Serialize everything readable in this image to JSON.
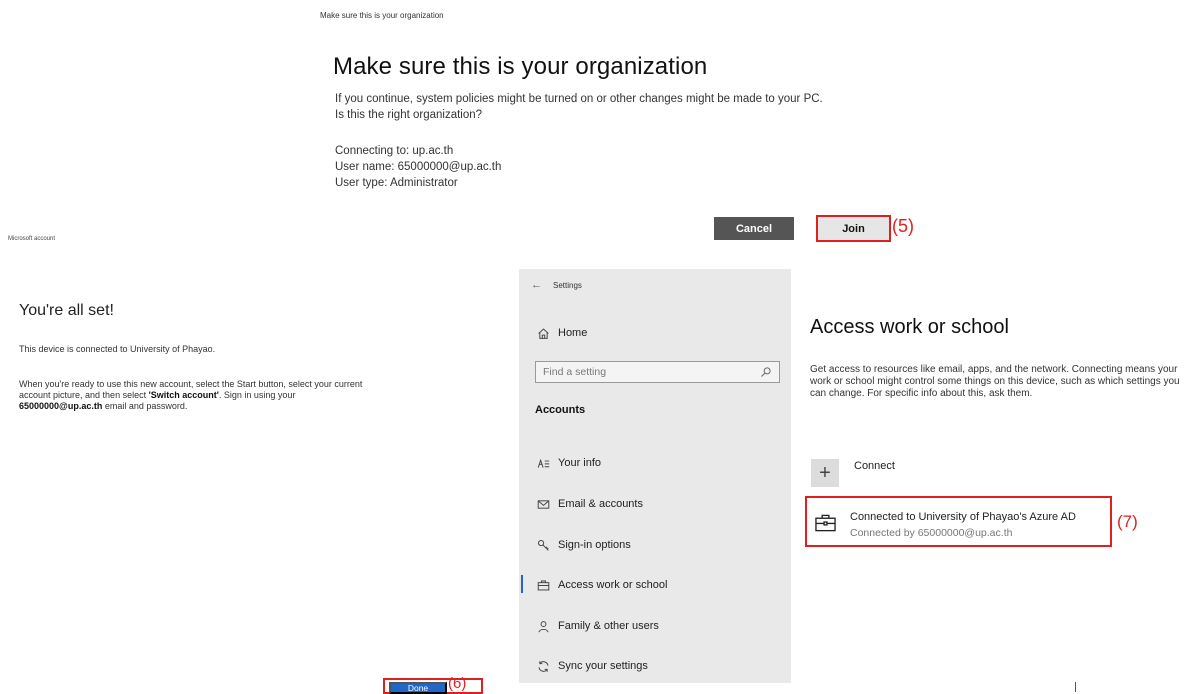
{
  "join_dialog": {
    "caption": "Make sure this is your organization",
    "title": "Make sure this is your organization",
    "message_line1": "If you continue, system policies might be turned on or other changes might be made to your PC.",
    "message_line2": "Is this the right organization?",
    "connecting_to": "Connecting to: up.ac.th",
    "user_name": "User name: 65000000@up.ac.th",
    "user_type": "User type: Administrator",
    "cancel_label": "Cancel",
    "join_label": "Join",
    "step_label": "(5)"
  },
  "all_set": {
    "caption": "Microsoft account",
    "title": "You're all set!",
    "connected_text": "This device is connected to University of Phayao.",
    "instructions_line1": "When you're ready to use this new account, select the Start button, select your current",
    "instructions_line2_pre": "account picture, and then select ",
    "instructions_switch": "'Switch account'",
    "instructions_line2_post": ". Sign in using your",
    "instructions_email": "65000000@up.ac.th",
    "instructions_line3_post": " email and password.",
    "done_label": "Done",
    "step_label": "(6)"
  },
  "settings": {
    "window_title": "Settings",
    "home_label": "Home",
    "search_placeholder": "Find a setting",
    "section_label": "Accounts",
    "nav_items": [
      {
        "label": "Your info",
        "icon": "person-list-icon"
      },
      {
        "label": "Email & accounts",
        "icon": "mail-icon"
      },
      {
        "label": "Sign-in options",
        "icon": "key-icon"
      },
      {
        "label": "Access work or school",
        "icon": "briefcase-icon",
        "active": true
      },
      {
        "label": "Family & other users",
        "icon": "person-icon"
      },
      {
        "label": "Sync your settings",
        "icon": "sync-icon"
      }
    ],
    "page_title": "Access work or school",
    "description": "Get access to resources like email, apps, and the network. Connecting means your work or school might control some things on this device, such as which settings you can change. For specific info about this, ask them.",
    "connect_label": "Connect",
    "connected_org_title": "Connected to University of Phayao's Azure AD",
    "connected_org_subtitle": "Connected by 65000000@up.ac.th",
    "step_label": "(7)"
  },
  "colors": {
    "accent_blue": "#1f67c9",
    "highlight_red": "#e02020",
    "sidebar_bg": "#e9e9e9",
    "cancel_bg": "#555555"
  }
}
